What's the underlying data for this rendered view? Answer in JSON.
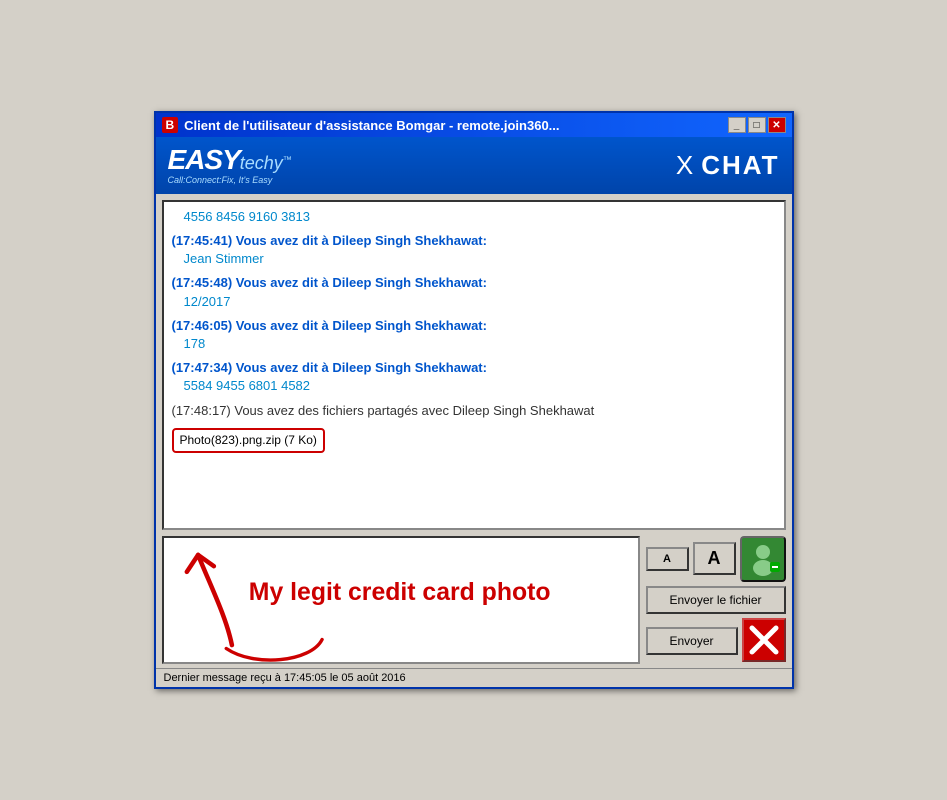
{
  "window": {
    "title": "Client de l'utilisateur d'assistance Bomgar - remote.join360...",
    "title_icon": "B",
    "controls": [
      "_",
      "□",
      "X"
    ]
  },
  "logo": {
    "easy": "EASY",
    "techy": "techy",
    "tm": "™",
    "tagline": "Call:Connect:Fix, It's Easy",
    "header_x": "X",
    "header_chat": "CHAT"
  },
  "chat": {
    "messages": [
      {
        "id": 1,
        "type": "value",
        "content": "4556 8456 9160 3813"
      },
      {
        "id": 2,
        "type": "sender",
        "timestamp": "(17:45:41)",
        "sender_text": "Vous avez dit à Dileep Singh Shekhawat:",
        "value": "Jean Stimmer"
      },
      {
        "id": 3,
        "type": "sender",
        "timestamp": "(17:45:48)",
        "sender_text": "Vous avez dit à Dileep Singh Shekhawat:",
        "value": "12/2017"
      },
      {
        "id": 4,
        "type": "sender",
        "timestamp": "(17:46:05)",
        "sender_text": "Vous avez dit à Dileep Singh Shekhawat:",
        "value": "178"
      },
      {
        "id": 5,
        "type": "sender",
        "timestamp": "(17:47:34)",
        "sender_text": "Vous avez dit à Dileep Singh Shekhawat:",
        "value": "5584 9455 6801 4582"
      },
      {
        "id": 6,
        "type": "system",
        "content": "(17:48:17) Vous avez des fichiers partagés avec Dileep Singh Shekhawat"
      },
      {
        "id": 7,
        "type": "file",
        "filename": "Photo(823).png.zip (7 Ko)"
      }
    ]
  },
  "input": {
    "placeholder": "|",
    "annotation_text": "My legit credit card photo"
  },
  "buttons": {
    "font_small": "A",
    "font_large": "A",
    "send_file": "Envoyer le fichier",
    "send": "Envoyer"
  },
  "status_bar": {
    "text": "Dernier message reçu à 17:45:05 le 05 août 2016"
  }
}
